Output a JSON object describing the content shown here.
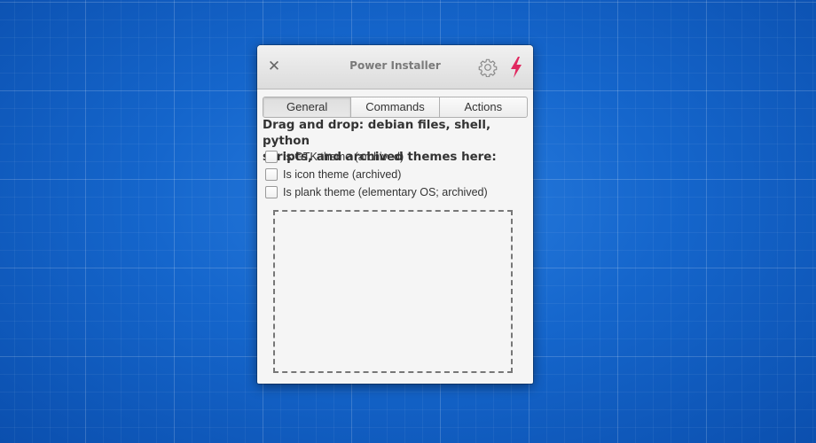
{
  "window": {
    "title": "Power Installer"
  },
  "titlebar": {
    "close_icon": "close-icon",
    "settings_icon": "gear-icon",
    "run_icon": "lightning-bolt-icon"
  },
  "tabs": [
    {
      "label": "General",
      "active": true
    },
    {
      "label": "Commands",
      "active": false
    },
    {
      "label": "Actions",
      "active": false
    }
  ],
  "general": {
    "instructions_line1": "Drag and drop: debian files, shell, python",
    "instructions_line2": "scripts, and archived themes here:",
    "options": [
      {
        "label": "Is GTK theme (archived)",
        "checked": false
      },
      {
        "label": "Is icon theme (archived)",
        "checked": false
      },
      {
        "label": "Is plank theme (elementary OS; archived)",
        "checked": false
      }
    ]
  },
  "colors": {
    "bolt": "#e0285f",
    "desktop": "#1566cc"
  }
}
